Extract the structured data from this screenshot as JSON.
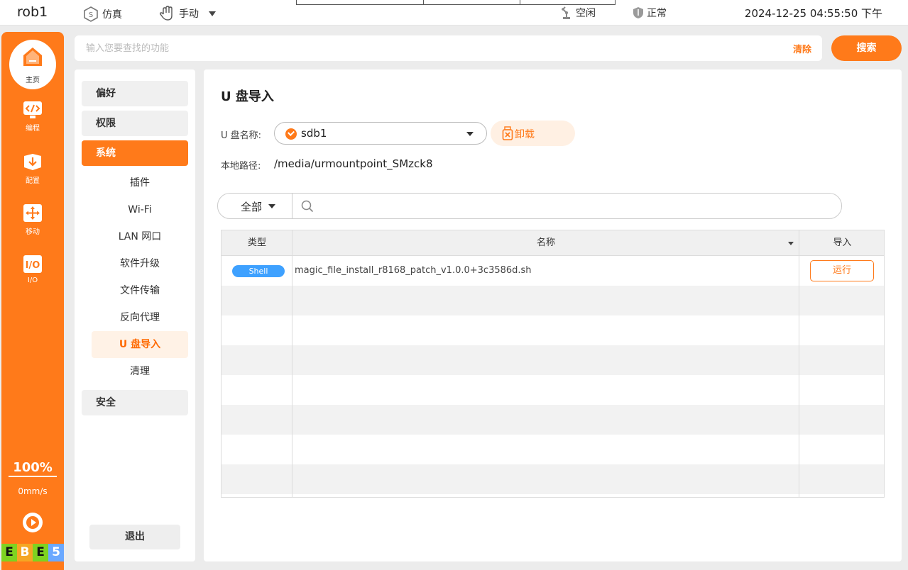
{
  "topbar": {
    "robot_name": "rob1",
    "sim_label": "仿真",
    "mode_label": "手动",
    "robot_state": "空闲",
    "safety_state": "正常",
    "datetime": "2024-12-25 04:55:50 下午"
  },
  "sidebar": {
    "home_label": "主页",
    "items": [
      {
        "label": "编程",
        "icon": "code-icon"
      },
      {
        "label": "配置",
        "icon": "config-icon"
      },
      {
        "label": "移动",
        "icon": "move-icon"
      },
      {
        "label": "I/O",
        "icon": "io-icon"
      }
    ],
    "speed_percent": "100%",
    "speed_value": "0mm/s",
    "status_letters": [
      "E",
      "B",
      "E",
      "5"
    ]
  },
  "search": {
    "placeholder": "输入您要查找的功能",
    "clear_label": "清除",
    "button_label": "搜索"
  },
  "menu": {
    "top_items": [
      "偏好",
      "权限",
      "系统",
      "安全"
    ],
    "active_top": "系统",
    "sub_items": [
      "插件",
      "Wi-Fi",
      "LAN 网口",
      "软件升级",
      "文件传输",
      "反向代理",
      "U 盘导入",
      "清理"
    ],
    "active_sub": "U 盘导入",
    "logout_label": "退出"
  },
  "main": {
    "title": "U 盘导入",
    "usb_name_label": "U 盘名称:",
    "usb_name_value": "sdb1",
    "unmount_label": "卸载",
    "local_path_label": "本地路径:",
    "local_path_value": "/media/urmountpoint_SMzck8",
    "filter_category": "全部",
    "filter_placeholder": ""
  },
  "table": {
    "columns": [
      "类型",
      "名称",
      "导入"
    ],
    "rows": [
      {
        "type": "Shell",
        "name": "magic_file_install_r8168_patch_v1.0.0+3c3586d.sh",
        "action": "运行"
      }
    ]
  },
  "colors": {
    "accent": "#ff7a1a",
    "badge_blue": "#3ea1ff",
    "status_green": "#7ed321",
    "status_orange": "#f5a623",
    "status_blue": "#6aa8ff"
  }
}
